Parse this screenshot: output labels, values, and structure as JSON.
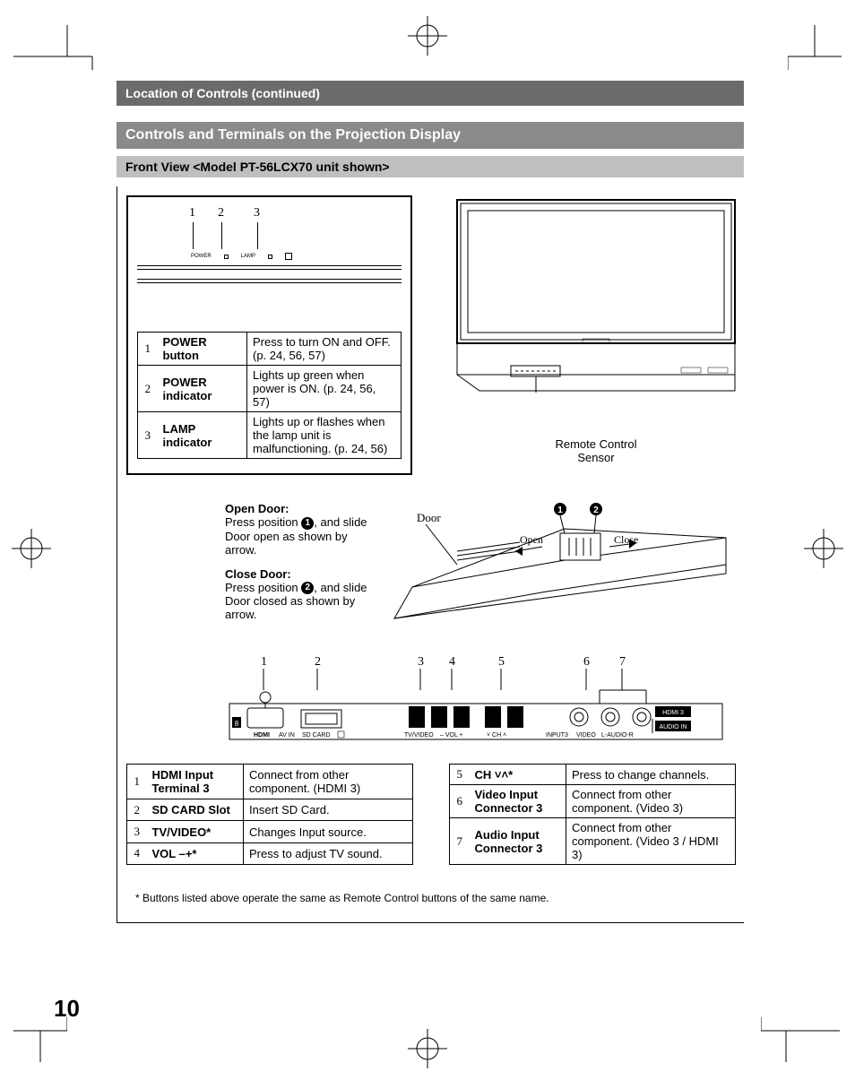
{
  "header": "Location of Controls (continued)",
  "section": "Controls and Terminals on the Projection Display",
  "sub": "Front View <Model PT-56LCX70 unit shown>",
  "top_panel_labels": {
    "power": "POWER",
    "lamp": "LAMP"
  },
  "top_callouts": [
    "1",
    "2",
    "3"
  ],
  "top_table": [
    {
      "n": "1",
      "name": "POWER button",
      "desc": "Press to turn ON and OFF. (p. 24, 56, 57)"
    },
    {
      "n": "2",
      "name": "POWER indicator",
      "desc": "Lights up green when power is ON. (p. 24, 56, 57)"
    },
    {
      "n": "3",
      "name": "LAMP indicator",
      "desc": "Lights up or flashes when the lamp unit is malfunctioning. (p. 24, 56)"
    }
  ],
  "sensor_label": "Remote Control\nSensor",
  "door": {
    "open_h": "Open Door:",
    "open_t": "Press position ①, and slide Door open as shown by arrow.",
    "close_h": "Close Door:",
    "close_t": "Press position ②, and slide Door closed as shown by arrow.",
    "word_door": "Door",
    "word_open": "Open",
    "word_close": "Close",
    "b1": "1",
    "b2": "2"
  },
  "conn_callouts": [
    "1",
    "2",
    "3",
    "4",
    "5",
    "6",
    "7"
  ],
  "conn_labels": {
    "hdmi": "HDMI",
    "avin": "AV IN",
    "sd": "SD CARD",
    "tvvideo": "TV/VIDEO",
    "volm": "– VOL +",
    "ch": "˅ CH ˄",
    "input3": "INPUT3",
    "video": "VIDEO",
    "laudio": "L-AUDIO-R",
    "hdmi3": "HDMI 3",
    "audioin": "AUDIO IN"
  },
  "left_table": [
    {
      "n": "1",
      "name": "HDMI Input Terminal 3",
      "desc": "Connect from other component. (HDMI 3)"
    },
    {
      "n": "2",
      "name": "SD CARD Slot",
      "desc": "Insert SD Card."
    },
    {
      "n": "3",
      "name": "TV/VIDEO*",
      "desc": "Changes Input source."
    },
    {
      "n": "4",
      "name": "VOL –+*",
      "desc": "Press to adjust TV sound."
    }
  ],
  "right_table": [
    {
      "n": "5",
      "name": "CH ˅˄*",
      "desc": "Press to change channels."
    },
    {
      "n": "6",
      "name": "Video Input Connector 3",
      "desc": "Connect from other component. (Video 3)"
    },
    {
      "n": "7",
      "name": "Audio Input Connector 3",
      "desc": "Connect from other component. (Video 3 / HDMI 3)"
    }
  ],
  "footnote": "* Buttons listed above operate the same as Remote Control buttons of the same name.",
  "page_number": "10"
}
